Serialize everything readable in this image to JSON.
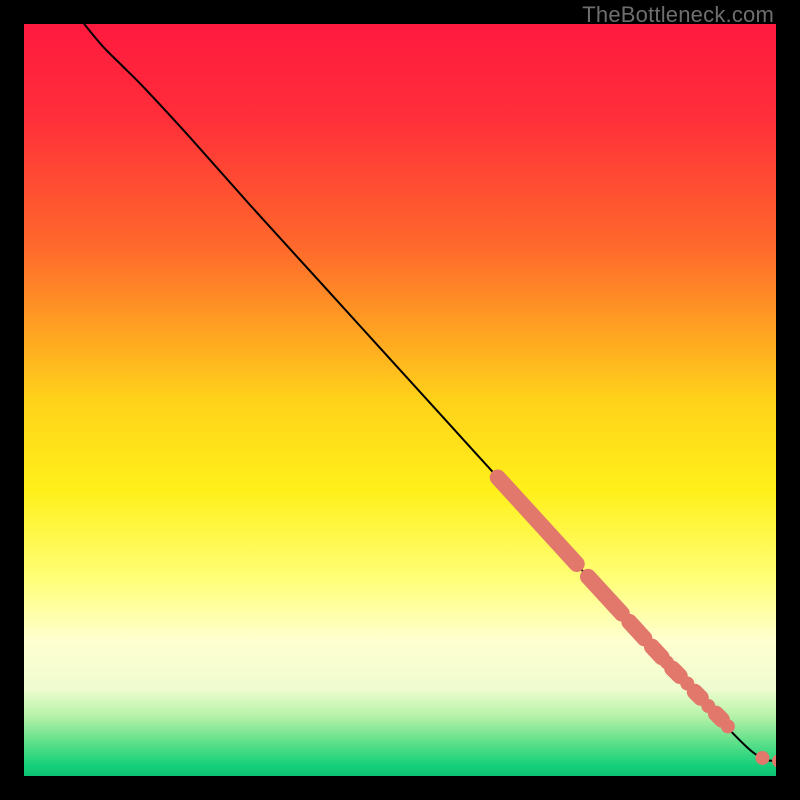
{
  "watermark": "TheBottleneck.com",
  "chart_data": {
    "type": "line",
    "title": "",
    "xlabel": "",
    "ylabel": "",
    "xlim": [
      0,
      100
    ],
    "ylim": [
      0,
      100
    ],
    "gradient_stops": [
      {
        "offset": 0.0,
        "color": "#ff1a3f"
      },
      {
        "offset": 0.12,
        "color": "#ff2d3a"
      },
      {
        "offset": 0.3,
        "color": "#ff6a2b"
      },
      {
        "offset": 0.5,
        "color": "#ffd21a"
      },
      {
        "offset": 0.62,
        "color": "#fff01a"
      },
      {
        "offset": 0.74,
        "color": "#ffff7a"
      },
      {
        "offset": 0.82,
        "color": "#ffffd0"
      },
      {
        "offset": 0.885,
        "color": "#eefccf"
      },
      {
        "offset": 0.92,
        "color": "#b6f2a8"
      },
      {
        "offset": 0.955,
        "color": "#5fe08a"
      },
      {
        "offset": 0.985,
        "color": "#17d07a"
      },
      {
        "offset": 1.0,
        "color": "#0dc274"
      }
    ],
    "curve": [
      {
        "x": 8.0,
        "y": 100.0
      },
      {
        "x": 10.5,
        "y": 97.0
      },
      {
        "x": 13.0,
        "y": 94.5
      },
      {
        "x": 16.0,
        "y": 91.5
      },
      {
        "x": 22.0,
        "y": 85.0
      },
      {
        "x": 30.0,
        "y": 76.0
      },
      {
        "x": 40.0,
        "y": 65.0
      },
      {
        "x": 50.0,
        "y": 54.0
      },
      {
        "x": 60.0,
        "y": 43.0
      },
      {
        "x": 70.0,
        "y": 32.0
      },
      {
        "x": 80.0,
        "y": 21.0
      },
      {
        "x": 88.0,
        "y": 12.5
      },
      {
        "x": 93.0,
        "y": 7.0
      },
      {
        "x": 96.5,
        "y": 3.5
      },
      {
        "x": 98.5,
        "y": 2.2
      },
      {
        "x": 100.0,
        "y": 2.0
      }
    ],
    "marker_clusters": [
      {
        "x0": 63.0,
        "y0": 39.7,
        "x1": 73.5,
        "y1": 28.2
      },
      {
        "x0": 75.0,
        "y0": 26.5,
        "x1": 79.5,
        "y1": 21.6
      },
      {
        "x0": 80.5,
        "y0": 20.5,
        "x1": 82.5,
        "y1": 18.3
      },
      {
        "x0": 83.5,
        "y0": 17.2,
        "x1": 84.8,
        "y1": 15.8
      },
      {
        "x0": 86.2,
        "y0": 14.3,
        "x1": 87.2,
        "y1": 13.3
      },
      {
        "x0": 89.2,
        "y0": 11.2,
        "x1": 90.0,
        "y1": 10.4
      },
      {
        "x0": 92.0,
        "y0": 8.3,
        "x1": 92.8,
        "y1": 7.5
      }
    ],
    "marker_points": [
      {
        "x": 85.5,
        "y": 15.1
      },
      {
        "x": 88.2,
        "y": 12.3
      },
      {
        "x": 91.0,
        "y": 9.3
      },
      {
        "x": 93.6,
        "y": 6.6
      },
      {
        "x": 98.2,
        "y": 2.4
      },
      {
        "x": 100.4,
        "y": 2.0
      },
      {
        "x": 101.5,
        "y": 2.0
      }
    ],
    "marker_color": "#e2776c",
    "marker_radius_px": 7,
    "cluster_radius_px": 8
  }
}
